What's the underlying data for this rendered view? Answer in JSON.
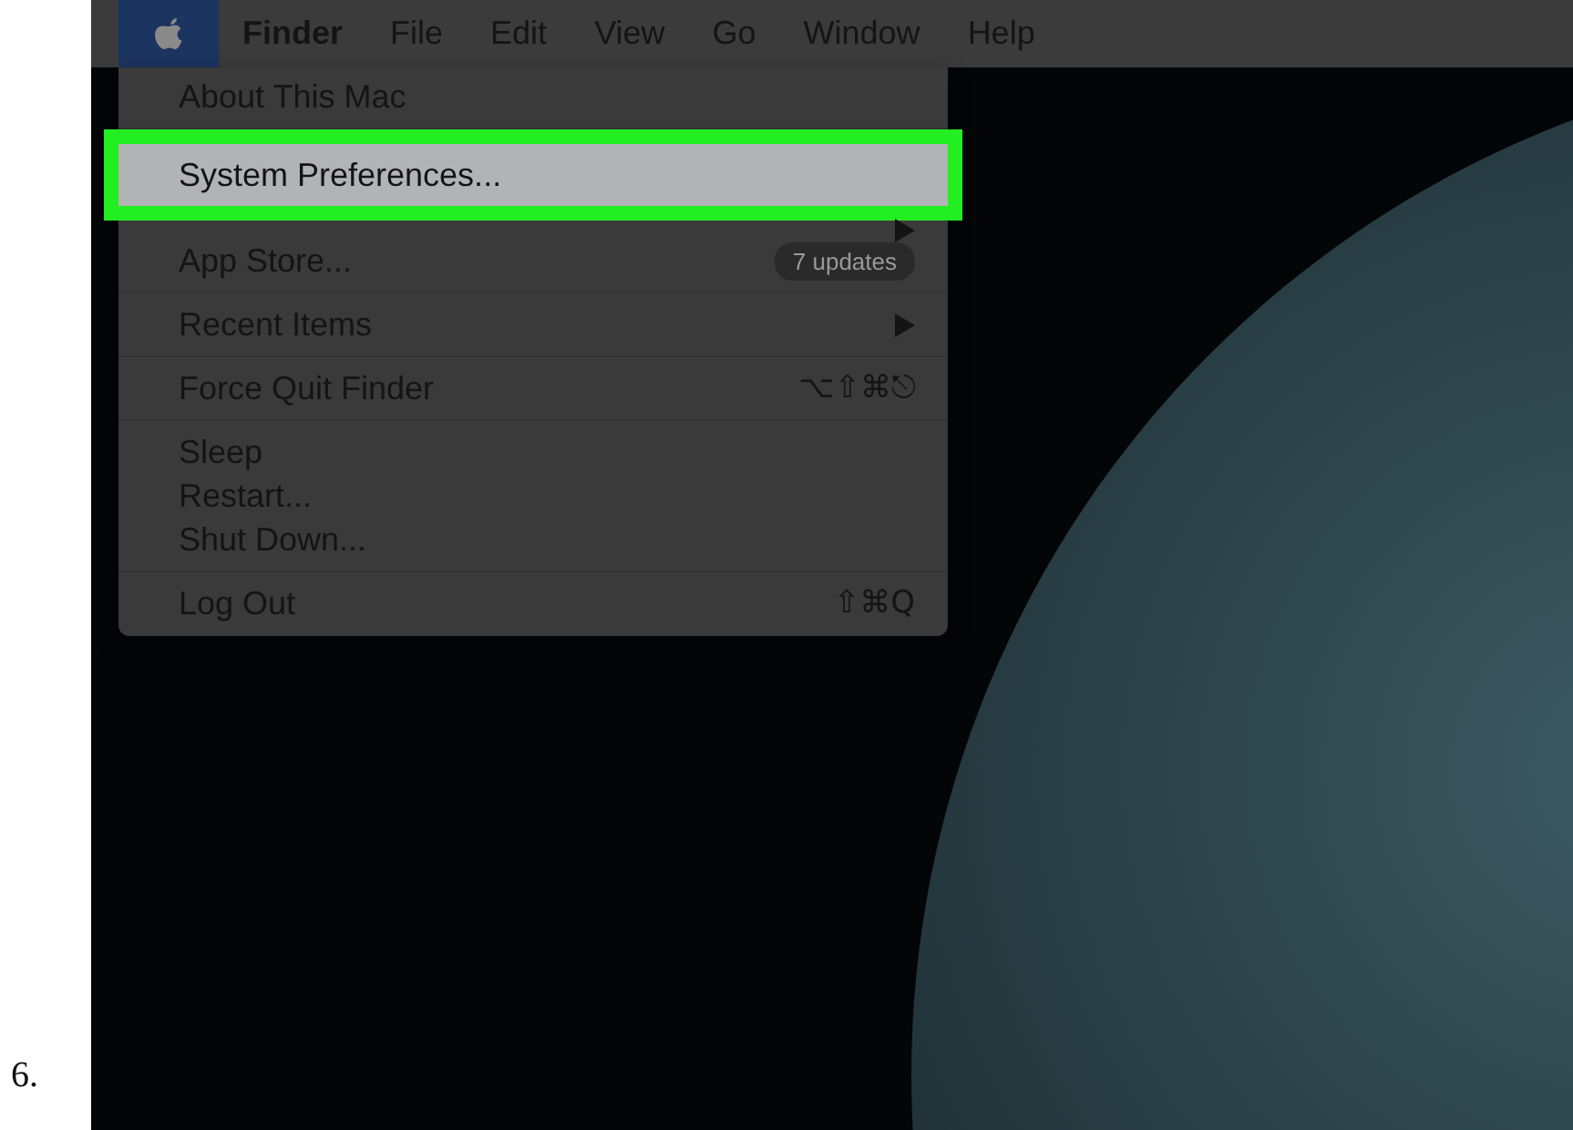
{
  "step_number": "6.",
  "menu_bar": {
    "items": [
      {
        "label": "Finder",
        "selected": false,
        "bold": true
      },
      {
        "label": "File",
        "selected": false,
        "bold": false
      },
      {
        "label": "Edit",
        "selected": false,
        "bold": false
      },
      {
        "label": "View",
        "selected": false,
        "bold": false
      },
      {
        "label": "Go",
        "selected": false,
        "bold": false
      },
      {
        "label": "Window",
        "selected": false,
        "bold": false
      },
      {
        "label": "Help",
        "selected": false,
        "bold": false
      }
    ],
    "apple_selected": true
  },
  "apple_menu": {
    "groups": [
      [
        {
          "kind": "item",
          "label": "About This Mac",
          "selected": false
        }
      ],
      [
        {
          "kind": "item",
          "label": "System Preferences...",
          "selected": true
        },
        {
          "kind": "covered",
          "submenu": true
        },
        {
          "kind": "item",
          "label": "App Store...",
          "badge": "7 updates",
          "selected": false
        }
      ],
      [
        {
          "kind": "item",
          "label": "Recent Items",
          "submenu": true,
          "selected": false
        }
      ],
      [
        {
          "kind": "item",
          "label": "Force Quit Finder",
          "shortcut": "⌥⇧⌘⎋",
          "selected": false
        }
      ],
      [
        {
          "kind": "item",
          "label": "Sleep",
          "selected": false
        },
        {
          "kind": "item",
          "label": "Restart...",
          "selected": false
        },
        {
          "kind": "item",
          "label": "Shut Down...",
          "selected": false
        }
      ],
      [
        {
          "kind": "item",
          "label": "Log Out",
          "shortcut": "⇧⌘Q",
          "selected": false
        }
      ]
    ]
  }
}
